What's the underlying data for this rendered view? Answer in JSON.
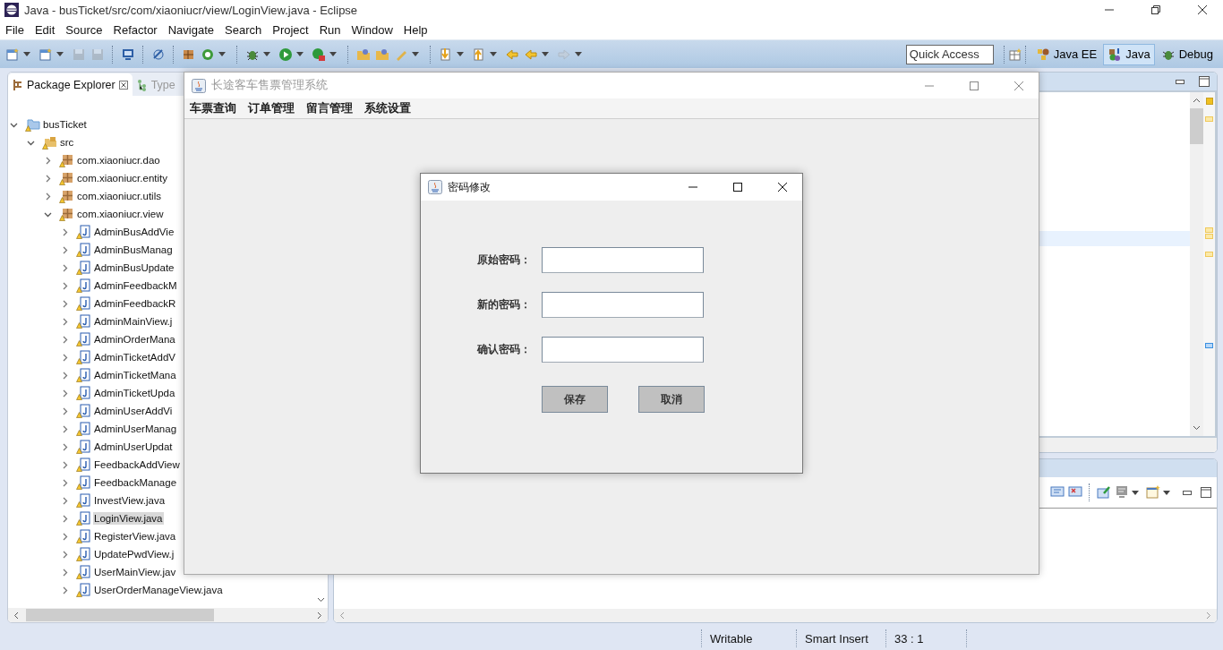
{
  "window": {
    "title": "Java - busTicket/src/com/xiaoniucr/view/LoginView.java - Eclipse"
  },
  "menu_bar": [
    "File",
    "Edit",
    "Source",
    "Refactor",
    "Navigate",
    "Search",
    "Project",
    "Run",
    "Window",
    "Help"
  ],
  "toolbar": {
    "quick_access": {
      "placeholder": "Quick Access"
    },
    "perspectives": [
      {
        "label": "Java EE",
        "selected": false
      },
      {
        "label": "Java",
        "selected": true
      },
      {
        "label": "Debug",
        "selected": false
      }
    ]
  },
  "package_explorer": {
    "tabs": [
      {
        "label": "Package Explorer",
        "selected": true
      },
      {
        "label": "Type",
        "selected": false
      }
    ],
    "tree": [
      {
        "label": "busTicket",
        "kind": "project",
        "expanded": true,
        "selected": false,
        "children": [
          {
            "label": "src",
            "kind": "source-folder",
            "expanded": true,
            "selected": false,
            "children": [
              {
                "label": "com.xiaoniucr.dao",
                "kind": "package",
                "expanded": false,
                "selected": false
              },
              {
                "label": "com.xiaoniucr.entity",
                "kind": "package",
                "expanded": false,
                "selected": false
              },
              {
                "label": "com.xiaoniucr.utils",
                "kind": "package",
                "expanded": false,
                "selected": false
              },
              {
                "label": "com.xiaoniucr.view",
                "kind": "package",
                "expanded": true,
                "selected": false,
                "children": [
                  {
                    "label": "AdminBusAddVie",
                    "kind": "java-file",
                    "expanded": false,
                    "selected": false
                  },
                  {
                    "label": "AdminBusManag",
                    "kind": "java-file",
                    "expanded": false,
                    "selected": false
                  },
                  {
                    "label": "AdminBusUpdate",
                    "kind": "java-file",
                    "expanded": false,
                    "selected": false
                  },
                  {
                    "label": "AdminFeedbackM",
                    "kind": "java-file",
                    "expanded": false,
                    "selected": false
                  },
                  {
                    "label": "AdminFeedbackR",
                    "kind": "java-file",
                    "expanded": false,
                    "selected": false
                  },
                  {
                    "label": "AdminMainView.j",
                    "kind": "java-file",
                    "expanded": false,
                    "selected": false
                  },
                  {
                    "label": "AdminOrderMana",
                    "kind": "java-file",
                    "expanded": false,
                    "selected": false
                  },
                  {
                    "label": "AdminTicketAddV",
                    "kind": "java-file",
                    "expanded": false,
                    "selected": false
                  },
                  {
                    "label": "AdminTicketMana",
                    "kind": "java-file",
                    "expanded": false,
                    "selected": false
                  },
                  {
                    "label": "AdminTicketUpda",
                    "kind": "java-file",
                    "expanded": false,
                    "selected": false
                  },
                  {
                    "label": "AdminUserAddVi",
                    "kind": "java-file",
                    "expanded": false,
                    "selected": false
                  },
                  {
                    "label": "AdminUserManag",
                    "kind": "java-file",
                    "expanded": false,
                    "selected": false
                  },
                  {
                    "label": "AdminUserUpdat",
                    "kind": "java-file",
                    "expanded": false,
                    "selected": false
                  },
                  {
                    "label": "FeedbackAddView",
                    "kind": "java-file",
                    "expanded": false,
                    "selected": false
                  },
                  {
                    "label": "FeedbackManage",
                    "kind": "java-file",
                    "expanded": false,
                    "selected": false
                  },
                  {
                    "label": "InvestView.java",
                    "kind": "java-file",
                    "expanded": false,
                    "selected": false
                  },
                  {
                    "label": "LoginView.java",
                    "kind": "java-file",
                    "expanded": false,
                    "selected": true
                  },
                  {
                    "label": "RegisterView.java",
                    "kind": "java-file",
                    "expanded": false,
                    "selected": false
                  },
                  {
                    "label": "UpdatePwdView.j",
                    "kind": "java-file",
                    "expanded": false,
                    "selected": false
                  },
                  {
                    "label": "UserMainView.jav",
                    "kind": "java-file",
                    "expanded": false,
                    "selected": false
                  },
                  {
                    "label": "UserOrderManageView.java",
                    "kind": "java-file",
                    "expanded": false,
                    "selected": false
                  }
                ]
              }
            ]
          }
        ]
      }
    ]
  },
  "status_bar": [
    "Writable",
    "Smart Insert",
    "33 : 1"
  ],
  "app_window": {
    "title": "长途客车售票管理系统",
    "active": false,
    "menu": [
      "车票查询",
      "订单管理",
      "留言管理",
      "系统设置"
    ]
  },
  "dialog": {
    "title": "密码修改",
    "active": true,
    "fields": [
      {
        "label": "原始密码："
      },
      {
        "label": "新的密码："
      },
      {
        "label": "确认密码："
      }
    ],
    "buttons": [
      "保存",
      "取消"
    ]
  }
}
